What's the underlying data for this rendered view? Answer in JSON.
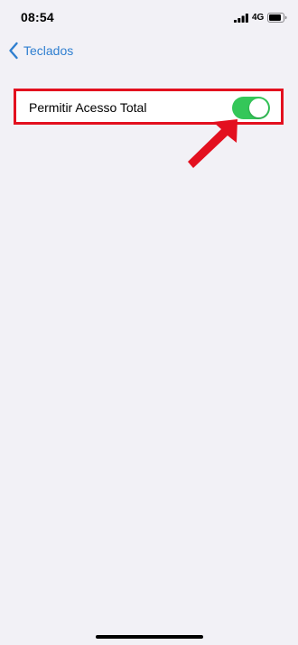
{
  "status_bar": {
    "time": "08:54",
    "network": "4G",
    "signal_icon": "cellular-signal-icon",
    "battery_icon": "battery-icon"
  },
  "navigation": {
    "back_label": "Teclados",
    "back_icon": "chevron-left-icon"
  },
  "settings": {
    "allow_full_access_label": "Permitir Acesso Total",
    "allow_full_access_enabled": true
  },
  "colors": {
    "background": "#f2f1f6",
    "accent_blue": "#2f7fd0",
    "toggle_on": "#34c759",
    "annotation_red": "#e3101f"
  },
  "annotation": {
    "arrow_icon": "pointing-arrow-icon"
  }
}
